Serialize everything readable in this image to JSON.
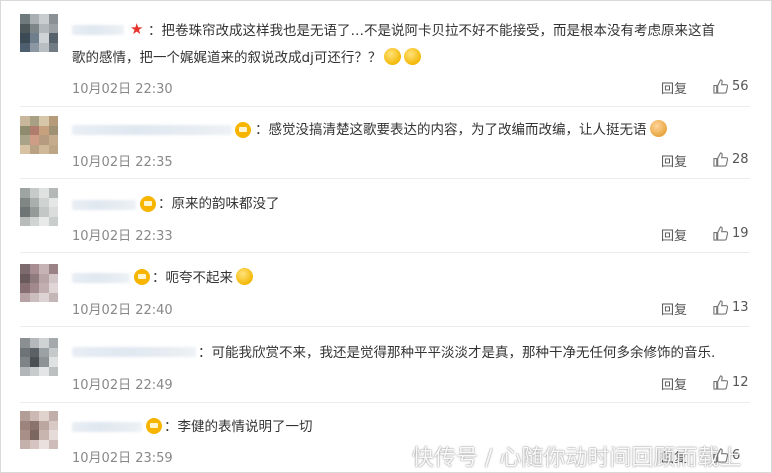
{
  "comments": [
    {
      "text": "把卷珠帘改成这样我也是无语了…不是说阿卡贝拉不好不能接受，而是根本没有考虑原来这首",
      "text2": "歌的感情，把一个娓娓道来的叙说改成dj可还行？？",
      "time": "10月02日 22:30",
      "reply": "回复",
      "likes": "56",
      "badge": "star"
    },
    {
      "text": "感觉没搞清楚这歌要表达的内容，为了改编而改编，让人挺无语",
      "time": "10月02日 22:35",
      "reply": "回复",
      "likes": "28",
      "badge": "crown"
    },
    {
      "text": "原来的韵味都没了",
      "time": "10月02日 22:33",
      "reply": "回复",
      "likes": "19",
      "badge": "crown"
    },
    {
      "text": "呃夸不起来",
      "time": "10月02日 22:40",
      "reply": "回复",
      "likes": "13",
      "badge": "crown"
    },
    {
      "text": "可能我欣赏不来，我还是觉得那种平平淡淡才是真，那种干净无任何多余修饰的音乐.",
      "time": "10月02日 22:49",
      "reply": "回复",
      "likes": "12",
      "badge": "crown"
    },
    {
      "text": "李健的表情说明了一切",
      "time": "10月02日 23:59",
      "reply": "回复",
      "likes": "6",
      "badge": "crown"
    }
  ],
  "watermark": "快传号 / 心随你动时间回顾而载上",
  "colors": {
    "text": "#333333",
    "meta": "#888888",
    "star": "#e8312b",
    "crown": "#f7b500"
  }
}
